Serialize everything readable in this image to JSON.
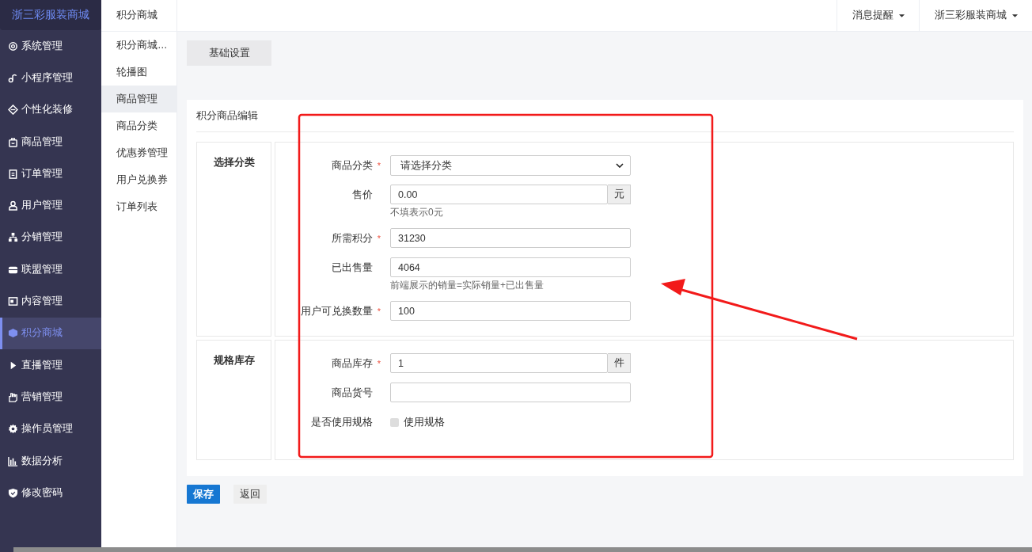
{
  "brand": "浙三彩服装商城",
  "sidebar": {
    "items": [
      {
        "label": "系统管理",
        "selected": false
      },
      {
        "label": "小程序管理",
        "selected": false
      },
      {
        "label": "个性化装修",
        "selected": false
      },
      {
        "label": "商品管理",
        "selected": false
      },
      {
        "label": "订单管理",
        "selected": false
      },
      {
        "label": "用户管理",
        "selected": false
      },
      {
        "label": "分销管理",
        "selected": false
      },
      {
        "label": "联盟管理",
        "selected": false
      },
      {
        "label": "内容管理",
        "selected": false
      },
      {
        "label": "积分商城",
        "selected": true
      },
      {
        "label": "直播管理",
        "selected": false
      },
      {
        "label": "营销管理",
        "selected": false
      },
      {
        "label": "操作员管理",
        "selected": false
      },
      {
        "label": "数据分析",
        "selected": false
      },
      {
        "label": "修改密码",
        "selected": false
      }
    ]
  },
  "submenu": {
    "title": "积分商城",
    "items": [
      {
        "label": "积分商城…",
        "selected": false
      },
      {
        "label": "轮播图",
        "selected": false
      },
      {
        "label": "商品管理",
        "selected": true
      },
      {
        "label": "商品分类",
        "selected": false
      },
      {
        "label": "优惠券管理",
        "selected": false
      },
      {
        "label": "用户兑换券",
        "selected": false
      },
      {
        "label": "订单列表",
        "selected": false
      }
    ]
  },
  "topbar": {
    "menus": [
      "消息提醒",
      "浙三彩服装商城"
    ]
  },
  "tabs": [
    {
      "label": "基础设置",
      "selected": true
    }
  ],
  "panel": {
    "title": "积分商品编辑",
    "sections": [
      {
        "title": "选择分类",
        "fields": [
          {
            "kind": "select",
            "label": "商品分类",
            "mark": "*",
            "value": "请选择分类"
          },
          {
            "kind": "input",
            "label": "售价",
            "value": "0.00",
            "addon": "元",
            "hint": "不填表示0元"
          },
          {
            "kind": "input",
            "label": "所需积分",
            "mark": "*",
            "value": "31230"
          },
          {
            "kind": "input",
            "label": "已出售量",
            "value": "4064",
            "hint": "前端展示的销量=实际销量+已出售量"
          },
          {
            "kind": "input",
            "label": "用户可兑换数量",
            "mark": "*",
            "value": "100"
          }
        ]
      },
      {
        "title": "规格库存",
        "fields": [
          {
            "kind": "input",
            "label": "商品库存",
            "mark": "*",
            "value": "1",
            "addon": "件"
          },
          {
            "kind": "input",
            "label": "商品货号"
          },
          {
            "kind": "checkbox",
            "label": "是否使用规格",
            "option": "使用规格",
            "checked": false
          }
        ]
      }
    ]
  },
  "buttons": [
    {
      "label": "保存",
      "kind": "primary"
    },
    {
      "label": "返回",
      "kind": "default"
    }
  ]
}
